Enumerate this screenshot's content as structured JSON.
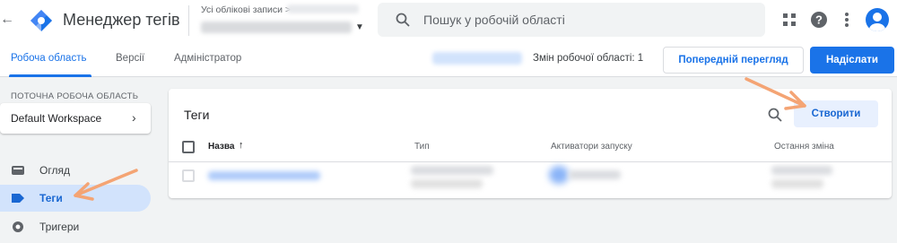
{
  "header": {
    "back_icon": "arrow-left-icon",
    "app_title": "Менеджер тегів",
    "account_label": "Усі облікові записи >",
    "search_placeholder": "Пошук у робочій області",
    "icons": [
      "apps-icon",
      "help-icon",
      "more-vert-icon",
      "account-avatar-icon"
    ]
  },
  "tabs": [
    {
      "label": "Робоча область",
      "active": true
    },
    {
      "label": "Версії",
      "active": false
    },
    {
      "label": "Адміністратор",
      "active": false
    }
  ],
  "toolbar": {
    "changes_text": "Змін робочої області: 1",
    "preview_label": "Попередній перегляд",
    "submit_label": "Надіслати"
  },
  "sidebar": {
    "workspace_label": "ПОТОЧНА РОБОЧА ОБЛАСТЬ",
    "workspace_name": "Default Workspace",
    "items": [
      {
        "label": "Огляд",
        "icon": "overview-icon",
        "active": false
      },
      {
        "label": "Теги",
        "icon": "tag-icon",
        "active": true
      },
      {
        "label": "Тригери",
        "icon": "trigger-icon",
        "active": false
      }
    ]
  },
  "main": {
    "title": "Теги",
    "create_label": "Створити",
    "columns": [
      "Назва",
      "Тип",
      "Активатори запуску",
      "Остання зміна"
    ],
    "sort_icon": "arrow-up-icon"
  },
  "colors": {
    "accent": "#1a73e8",
    "active_nav_bg": "#d2e3fc",
    "annotation_arrow": "#f4a474"
  }
}
